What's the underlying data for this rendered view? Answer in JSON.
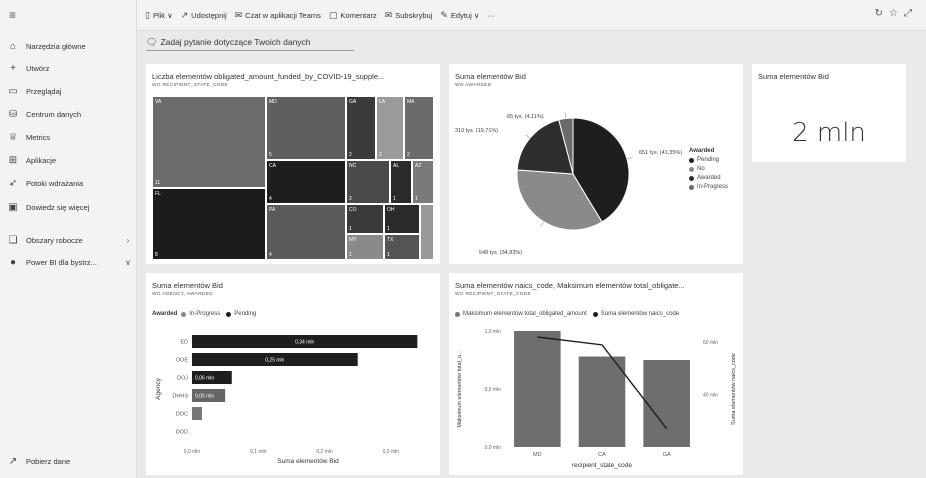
{
  "sidebar": {
    "items": [
      {
        "icon": "home-icon",
        "glyph": "⌂",
        "label": "Narzędzia główne"
      },
      {
        "icon": "plus-icon",
        "glyph": "+",
        "label": "Utwórz"
      },
      {
        "icon": "folder-icon",
        "glyph": "▭",
        "label": "Przeglądaj"
      },
      {
        "icon": "database-icon",
        "glyph": "⛁",
        "label": "Centrum danych"
      },
      {
        "icon": "trophy-icon",
        "glyph": "♕",
        "label": "Metrics"
      },
      {
        "icon": "apps-icon",
        "glyph": "⊞",
        "label": "Aplikacje"
      },
      {
        "icon": "rocket-icon",
        "glyph": "➶",
        "label": "Potoki wdrażania"
      },
      {
        "icon": "book-icon",
        "glyph": "▣",
        "label": "Dowiedz się więcej"
      },
      {
        "icon": "workspaces-icon",
        "glyph": "❏",
        "label": "Obszary robocze"
      },
      {
        "icon": "powerbi-icon",
        "glyph": "●",
        "label": "Power BI dla bystrz..."
      }
    ],
    "footer": "Pobierz dane"
  },
  "toolbar": {
    "items": [
      {
        "icon": "file-icon",
        "glyph": "▯",
        "label": "Plik ∨"
      },
      {
        "icon": "share-icon",
        "glyph": "↗",
        "label": "Udostępnij"
      },
      {
        "icon": "teams-icon",
        "glyph": "✉",
        "label": "Czat w aplikacji Teams"
      },
      {
        "icon": "comment-icon",
        "glyph": "▢",
        "label": "Komentarz"
      },
      {
        "icon": "subscribe-icon",
        "glyph": "✉",
        "label": "Subskrybuj"
      },
      {
        "icon": "edit-icon",
        "glyph": "✎",
        "label": "Edytuj ∨"
      },
      {
        "icon": "more-icon",
        "glyph": "",
        "label": "···"
      }
    ]
  },
  "qna": {
    "placeholder": "Zadaj pytanie dotyczące Twoich danych"
  },
  "treemap": {
    "title": "Liczba elementów obligated_amount_funded_by_COVID-19_supple...",
    "subtitle": "WG RECIPIENT_STATE_CODE",
    "tiles": [
      {
        "name": "VA",
        "count": "11"
      },
      {
        "name": "FL",
        "count": "8"
      },
      {
        "name": "MD",
        "count": "5"
      },
      {
        "name": "CA",
        "count": "4"
      },
      {
        "name": "PA",
        "count": "4"
      },
      {
        "name": "GA",
        "count": "2"
      },
      {
        "name": "LA",
        "count": "2"
      },
      {
        "name": "MA",
        "count": "2"
      },
      {
        "name": "NC",
        "count": "2"
      },
      {
        "name": "AL",
        "count": "1"
      },
      {
        "name": "AZ",
        "count": "1"
      },
      {
        "name": "CO",
        "count": "1"
      },
      {
        "name": "OH",
        "count": "1"
      },
      {
        "name": "MY",
        "count": "1"
      },
      {
        "name": "TX",
        "count": "1"
      }
    ]
  },
  "pie": {
    "title": "Suma elementów Bid",
    "subtitle": "WG AWARDED",
    "legend_title": "Awarded",
    "slices": [
      {
        "label": "Pending",
        "value": 41.35,
        "text": "651 tys. (41,35%)",
        "color": "#1e1e1e"
      },
      {
        "label": "No",
        "value": 34.83,
        "text": "548 tys. (34,83%)",
        "color": "#8a8a8a"
      },
      {
        "label": "Awarded",
        "value": 19.71,
        "text": "310 tys. (19,71%)",
        "color": "#2e2e2e"
      },
      {
        "label": "In-Progress",
        "value": 4.11,
        "text": "65 tys. (4,11%)",
        "color": "#6a6a6a"
      }
    ]
  },
  "card": {
    "title": "Suma elementów Bid",
    "value": "2 mln"
  },
  "barchart": {
    "title": "Suma elementów Bid",
    "subtitle": "WG AGENCY, AWARDED",
    "legend_title": "Awarded",
    "legend": [
      {
        "name": "In-Progress",
        "color": "#888888"
      },
      {
        "name": "Pending",
        "color": "#1e1e1e"
      }
    ],
    "ylabel": "Agency",
    "xlabel": "Suma elementów Bid",
    "xticks": [
      "0,0 mln",
      "0,1 mln",
      "0,2 mln",
      "0,3 mln"
    ],
    "xmax": 0.35,
    "bars": [
      {
        "cat": "ED",
        "value": 0.34,
        "label": "0,34 mln",
        "color": "#1e1e1e"
      },
      {
        "cat": "DOE",
        "value": 0.25,
        "label": "0,25 mln",
        "color": "#1e1e1e"
      },
      {
        "cat": "DOJ",
        "value": 0.06,
        "label": "0,06 mln",
        "color": "#1e1e1e"
      },
      {
        "cat": "DHHS",
        "value": 0.05,
        "label": "0,05 mln",
        "color": "#666666"
      },
      {
        "cat": "DOC",
        "value": 0.015,
        "label": "",
        "color": "#777777"
      },
      {
        "cat": "DOD",
        "value": 0.0,
        "label": "",
        "color": "#777777"
      }
    ]
  },
  "combo": {
    "title": "Suma elementów naics_code, Maksimum elementów total_obligate...",
    "subtitle": "WG RECIPIENT_STATE_CODE",
    "legend": [
      {
        "name": "Maksimum elementów total_obligated_amount",
        "color": "#777777"
      },
      {
        "name": "Suma elementów naics_code",
        "color": "#1e1e1e"
      }
    ],
    "xlabel": "recipient_state_code",
    "ylabel_left": "Maksimum elementów total_o...",
    "ylabel_right": "Suma elementów naics_code",
    "left_ticks": [
      "1,0 mln",
      "0,5 mln",
      "0,0 mln"
    ],
    "right_ticks": [
      "60 mln",
      "40 mln"
    ],
    "categories": [
      "MD",
      "CA",
      "GA"
    ],
    "bar_values": [
      1.0,
      0.78,
      0.75
    ],
    "line_values": [
      62,
      59,
      27
    ]
  }
}
